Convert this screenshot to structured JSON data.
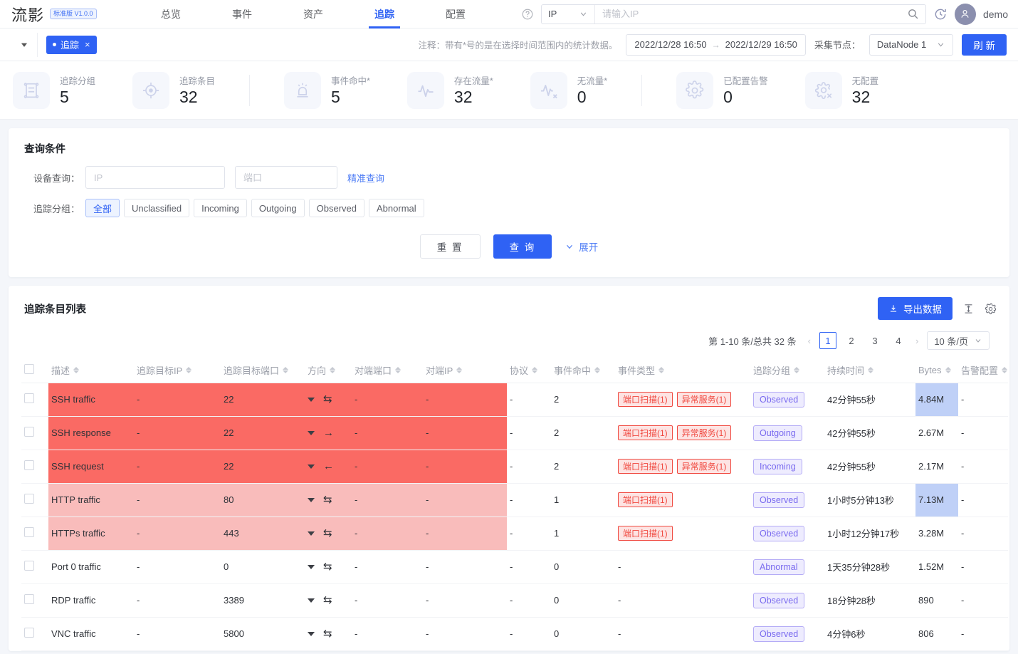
{
  "header": {
    "brand": "流影",
    "brand_badge": "标准版 V1.0.0",
    "nav": [
      {
        "label": "总览",
        "active": false
      },
      {
        "label": "事件",
        "active": false
      },
      {
        "label": "资产",
        "active": false
      },
      {
        "label": "追踪",
        "active": true
      },
      {
        "label": "配置",
        "active": false
      }
    ],
    "help_icon": "question-circle-icon",
    "search_scope": "IP",
    "search_placeholder": "请输入IP",
    "search_value": "",
    "search_icon": "search-icon",
    "history_icon": "history-clock-icon",
    "avatar_icon": "user-avatar-icon",
    "user": "demo"
  },
  "tabbar": {
    "collapse_icon": "caret-down-icon",
    "tab_label": "追踪",
    "tab_close": "×",
    "note": "注释：带有*号的是在选择时间范围内的统计数据。",
    "date_start": "2022/12/28 16:50",
    "date_arrow": "→",
    "date_end": "2022/12/29 16:50",
    "node_label": "采集节点：",
    "node_value": "DataNode 1",
    "refresh_label": "刷 新"
  },
  "stats": [
    {
      "icon": "scroll-list-icon",
      "label": "追踪分组",
      "value": "5"
    },
    {
      "icon": "target-crosshair-icon",
      "label": "追踪条目",
      "value": "32"
    },
    {
      "icon": "alarm-bell-icon",
      "label": "事件命中*",
      "value": "5"
    },
    {
      "icon": "pulse-wave-icon",
      "label": "存在流量*",
      "value": "32"
    },
    {
      "icon": "pulse-wave-x-icon",
      "label": "无流量*",
      "value": "0"
    },
    {
      "icon": "gear-icon",
      "label": "已配置告警",
      "value": "0"
    },
    {
      "icon": "gear-x-icon",
      "label": "无配置",
      "value": "32"
    }
  ],
  "query": {
    "title": "查询条件",
    "device_label": "设备查询：",
    "ip_placeholder": "IP",
    "ip_value": "",
    "port_placeholder": "端口",
    "port_value": "",
    "precise_link": "精准查询",
    "group_label": "追踪分组：",
    "groups": [
      {
        "label": "全部",
        "active": true
      },
      {
        "label": "Unclassified",
        "active": false
      },
      {
        "label": "Incoming",
        "active": false
      },
      {
        "label": "Outgoing",
        "active": false
      },
      {
        "label": "Observed",
        "active": false
      },
      {
        "label": "Abnormal",
        "active": false
      }
    ],
    "reset_label": "重 置",
    "query_label": "查 询",
    "expand_label": "展开",
    "expand_icon": "chevron-down-icon"
  },
  "list": {
    "title": "追踪条目列表",
    "export_label": "导出数据",
    "export_icon": "download-icon",
    "row_height_icon": "row-height-icon",
    "settings_icon": "gear-icon",
    "pager_info": "第 1-10 条/总共 32 条",
    "prev_icon": "‹",
    "next_icon": "›",
    "pages": [
      "1",
      "2",
      "3",
      "4"
    ],
    "current_page": "1",
    "page_size": "10 条/页",
    "columns": [
      {
        "key": "desc",
        "label": "描述",
        "sortable": true
      },
      {
        "key": "ip",
        "label": "追踪目标IP",
        "sortable": true
      },
      {
        "key": "port",
        "label": "追踪目标端口",
        "sortable": true
      },
      {
        "key": "dir",
        "label": "方向",
        "sortable": true
      },
      {
        "key": "pport",
        "label": "对端端口",
        "sortable": true
      },
      {
        "key": "pip",
        "label": "对端IP",
        "sortable": true
      },
      {
        "key": "proto",
        "label": "协议",
        "sortable": true
      },
      {
        "key": "hit",
        "label": "事件命中",
        "sortable": true
      },
      {
        "key": "etype",
        "label": "事件类型",
        "sortable": true
      },
      {
        "key": "grp",
        "label": "追踪分组",
        "sortable": true
      },
      {
        "key": "dur",
        "label": "持续时间",
        "sortable": true
      },
      {
        "key": "bytes",
        "label": "Bytes",
        "sortable": true
      },
      {
        "key": "alarm",
        "label": "告警配置",
        "sortable": true
      }
    ],
    "rows": [
      {
        "severity": "high",
        "desc": "SSH traffic",
        "ip": "-",
        "port": "22",
        "dir_icon": "bidirectional-icon",
        "dir_glyph": "⇆",
        "pport": "-",
        "pip": "-",
        "proto": "-",
        "hit": "2",
        "etype": [
          "端口扫描(1)",
          "异常服务(1)"
        ],
        "grp": "Observed",
        "dur": "42分钟55秒",
        "bytes": "4.84M",
        "bytes_hl": true,
        "alarm": "-"
      },
      {
        "severity": "high",
        "desc": "SSH response",
        "ip": "-",
        "port": "22",
        "dir_icon": "arrow-right-icon",
        "dir_glyph": "→",
        "pport": "-",
        "pip": "-",
        "proto": "-",
        "hit": "2",
        "etype": [
          "端口扫描(1)",
          "异常服务(1)"
        ],
        "grp": "Outgoing",
        "dur": "42分钟55秒",
        "bytes": "2.67M",
        "bytes_hl": false,
        "alarm": "-"
      },
      {
        "severity": "high",
        "desc": "SSH request",
        "ip": "-",
        "port": "22",
        "dir_icon": "arrow-left-icon",
        "dir_glyph": "←",
        "pport": "-",
        "pip": "-",
        "proto": "-",
        "hit": "2",
        "etype": [
          "端口扫描(1)",
          "异常服务(1)"
        ],
        "grp": "Incoming",
        "dur": "42分钟55秒",
        "bytes": "2.17M",
        "bytes_hl": false,
        "alarm": "-"
      },
      {
        "severity": "med",
        "desc": "HTTP traffic",
        "ip": "-",
        "port": "80",
        "dir_icon": "bidirectional-icon",
        "dir_glyph": "⇆",
        "pport": "-",
        "pip": "-",
        "proto": "-",
        "hit": "1",
        "etype": [
          "端口扫描(1)"
        ],
        "grp": "Observed",
        "dur": "1小时5分钟13秒",
        "bytes": "7.13M",
        "bytes_hl": true,
        "alarm": "-"
      },
      {
        "severity": "med",
        "desc": "HTTPs traffic",
        "ip": "-",
        "port": "443",
        "dir_icon": "bidirectional-icon",
        "dir_glyph": "⇆",
        "pport": "-",
        "pip": "-",
        "proto": "-",
        "hit": "1",
        "etype": [
          "端口扫描(1)"
        ],
        "grp": "Observed",
        "dur": "1小时12分钟17秒",
        "bytes": "3.28M",
        "bytes_hl": false,
        "alarm": "-"
      },
      {
        "severity": "none",
        "desc": "Port 0 traffic",
        "ip": "-",
        "port": "0",
        "dir_icon": "bidirectional-icon",
        "dir_glyph": "⇆",
        "pport": "-",
        "pip": "-",
        "proto": "-",
        "hit": "0",
        "etype": [],
        "etype_empty": "-",
        "grp": "Abnormal",
        "dur": "1天35分钟28秒",
        "bytes": "1.52M",
        "bytes_hl": false,
        "alarm": "-"
      },
      {
        "severity": "none",
        "desc": "RDP traffic",
        "ip": "-",
        "port": "3389",
        "dir_icon": "bidirectional-icon",
        "dir_glyph": "⇆",
        "pport": "-",
        "pip": "-",
        "proto": "-",
        "hit": "0",
        "etype": [],
        "etype_empty": "-",
        "grp": "Observed",
        "dur": "18分钟28秒",
        "bytes": "890",
        "bytes_hl": false,
        "alarm": "-"
      },
      {
        "severity": "none",
        "desc": "VNC traffic",
        "ip": "-",
        "port": "5800",
        "dir_icon": "bidirectional-icon",
        "dir_glyph": "⇆",
        "pport": "-",
        "pip": "-",
        "proto": "-",
        "hit": "0",
        "etype": [],
        "etype_empty": "-",
        "grp": "Observed",
        "dur": "4分钟6秒",
        "bytes": "806",
        "bytes_hl": false,
        "alarm": "-"
      }
    ]
  },
  "colors": {
    "accent": "#2f62f4",
    "severity_high": "#fa6a64",
    "severity_med": "#f9bcbb",
    "tag_event": "#f0483f",
    "tag_group": "#7a6bef",
    "bytes_highlight": "#bfd0f7"
  }
}
